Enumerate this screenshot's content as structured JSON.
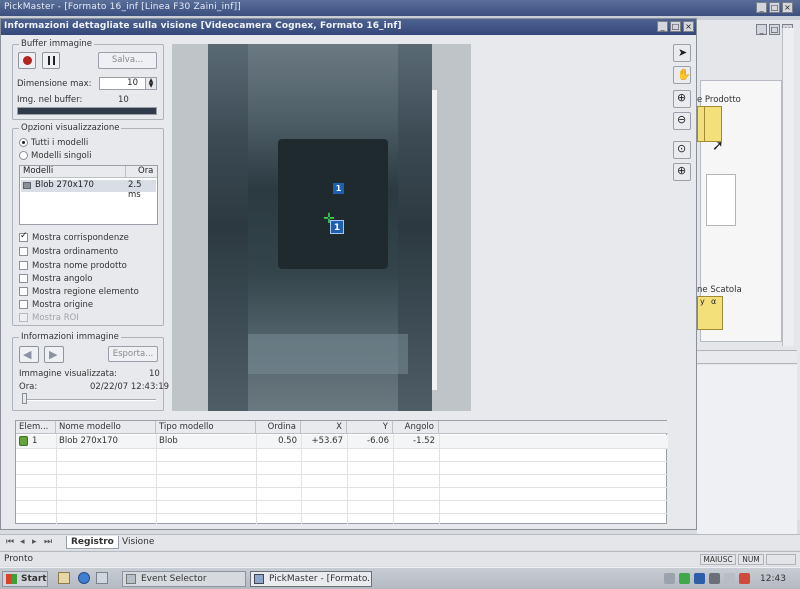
{
  "app_window": {
    "title": "PickMaster - [Formato 16_inf [Linea F30 Zaini_inf]]"
  },
  "dialog": {
    "title": "Informazioni dettagliate sulla visione [Videocamera Cognex, Formato 16_inf]"
  },
  "buffer_group": {
    "label": "Buffer immagine",
    "save_label": "Salva...",
    "max_size_label": "Dimensione max:",
    "max_size_value": "10",
    "images_in_buffer_label": "Img. nel buffer:",
    "images_in_buffer_value": "10",
    "buffer_fill_percent": 100
  },
  "display_options": {
    "label": "Opzioni visualizzazione",
    "radio_all": "Tutti i modelli",
    "radio_single": "Modelli singoli",
    "radio_selected": "all",
    "list_header_model": "Modelli",
    "list_header_time": "Ora",
    "models": [
      {
        "name": "Blob 270x170",
        "time": "2.5 ms"
      }
    ],
    "checkboxes": [
      {
        "label": "Mostra corrispondenze",
        "checked": true,
        "enabled": true
      },
      {
        "label": "Mostra ordinamento",
        "checked": false,
        "enabled": true
      },
      {
        "label": "Mostra nome prodotto",
        "checked": false,
        "enabled": true
      },
      {
        "label": "Mostra angolo",
        "checked": false,
        "enabled": true
      },
      {
        "label": "Mostra regione elemento",
        "checked": false,
        "enabled": true
      },
      {
        "label": "Mostra origine",
        "checked": false,
        "enabled": true
      },
      {
        "label": "Mostra ROI",
        "checked": false,
        "enabled": false
      }
    ]
  },
  "image_info": {
    "label": "Informazioni immagine",
    "export_label": "Esporta...",
    "displayed_image_label": "Immagine visualizzata:",
    "displayed_image_value": "10",
    "time_label": "Ora:",
    "time_value": "02/22/07 12:43:19"
  },
  "camera_markers": [
    {
      "label": "1"
    },
    {
      "label": "1"
    }
  ],
  "results_table": {
    "headers": [
      "Elem...",
      "Nome modello",
      "Tipo modello",
      "Ordina",
      "X",
      "Y",
      "Angolo"
    ],
    "rows": [
      {
        "elem": "1",
        "model_name": "Blob 270x170",
        "model_type": "Blob",
        "order": "0.50",
        "x": "+53.67",
        "y": "-6.06",
        "angle": "-1.52"
      }
    ]
  },
  "background_fragments": {
    "prodotto": "e Prodotto",
    "scatola": "ne Scatola",
    "col_y": "y",
    "col_alpha": "α"
  },
  "tabs": [
    {
      "label": "Registro",
      "active": true
    },
    {
      "label": "Visione",
      "active": false
    }
  ],
  "statusbar": {
    "status": "Pronto",
    "caps": "MAIUSC",
    "num": "NUM"
  },
  "taskbar": {
    "start": "Start",
    "tasks": [
      {
        "label": "Event Selector",
        "active": false
      },
      {
        "label": "PickMaster - [Formato...",
        "active": true
      }
    ],
    "clock": "12:43"
  },
  "colors": {
    "marker_blue": "#1f5fb0",
    "marker_green": "#3fd14a",
    "title_bar": "#3c5080",
    "tile_yellow": "#f4e07a"
  }
}
